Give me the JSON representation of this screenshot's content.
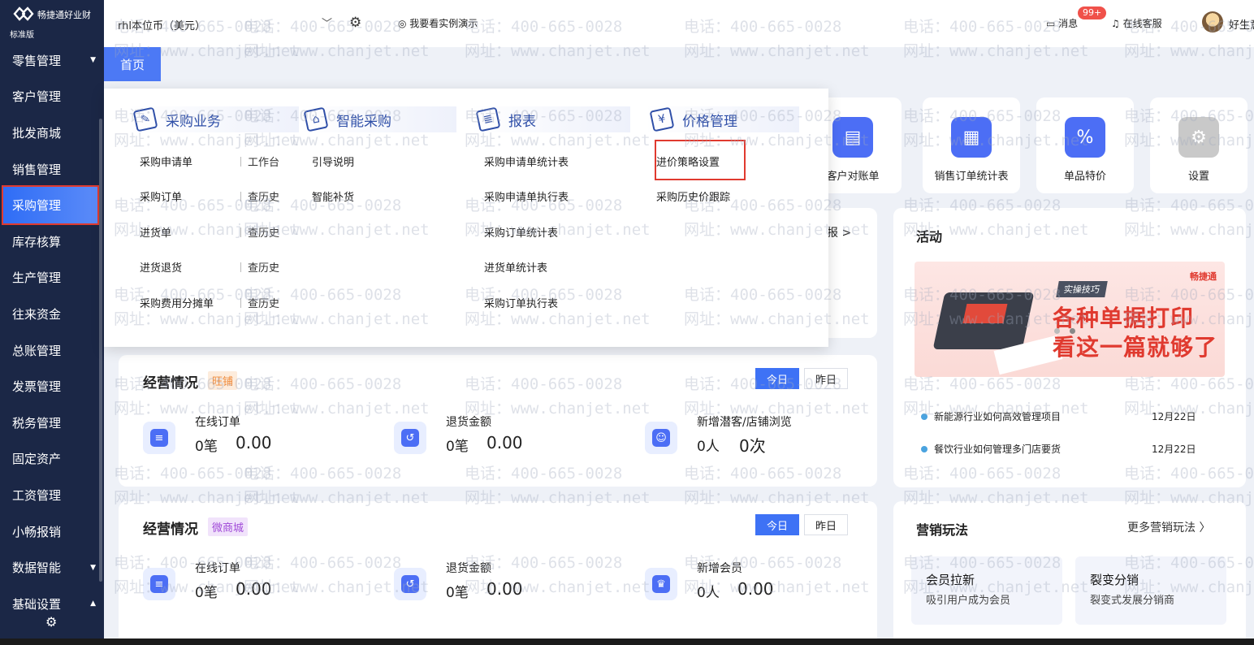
{
  "app": {
    "brand_name": "畅捷通好业财",
    "edition": "标准版"
  },
  "sidebar": {
    "items": [
      {
        "label": "零售管理",
        "caret": "▼"
      },
      {
        "label": "客户管理"
      },
      {
        "label": "批发商城"
      },
      {
        "label": "销售管理"
      },
      {
        "label": "采购管理",
        "active": true
      },
      {
        "label": "库存核算"
      },
      {
        "label": "生产管理"
      },
      {
        "label": "往来资金"
      },
      {
        "label": "总账管理"
      },
      {
        "label": "发票管理"
      },
      {
        "label": "税务管理"
      },
      {
        "label": "固定资产"
      },
      {
        "label": "工资管理"
      },
      {
        "label": "小畅报销"
      },
      {
        "label": "数据智能",
        "caret": "▼"
      },
      {
        "label": "基础设置",
        "caret": "▲"
      }
    ],
    "settings_icon": "gear-icon"
  },
  "topbar": {
    "currency": "rhl本位币（美元）",
    "demo": "我要看实例演示",
    "messages": "消息",
    "badge": "99+",
    "service": "在线客服",
    "user": "好生意"
  },
  "tabs": {
    "home": "首页"
  },
  "mega": {
    "columns": [
      {
        "title": "采购业务",
        "icon": "purchase-icon"
      },
      {
        "title": "智能采购",
        "icon": "basket-icon"
      },
      {
        "title": "报表",
        "icon": "report-icon"
      },
      {
        "title": "价格管理",
        "icon": "price-tag-icon"
      }
    ],
    "purchase_items": [
      {
        "label": "采购申请单",
        "extra": "工作台"
      },
      {
        "label": "采购订单",
        "extra": "查历史"
      },
      {
        "label": "进货单",
        "extra": "查历史"
      },
      {
        "label": "进货退货",
        "extra": "查历史"
      },
      {
        "label": "采购费用分摊单",
        "extra": "查历史"
      }
    ],
    "smart_items": [
      "引导说明",
      "智能补货"
    ],
    "report_items": [
      "采购申请单统计表",
      "采购申请单执行表",
      "采购订单统计表",
      "进货单统计表",
      "采购订单执行表"
    ],
    "price_items": [
      "进价策略设置",
      "采购历史价跟踪"
    ]
  },
  "quick": [
    {
      "label": "客户对账单",
      "icon": "statement-icon"
    },
    {
      "label": "销售订单统计表",
      "icon": "report-icon"
    },
    {
      "label": "单品特价",
      "icon": "discount-icon"
    },
    {
      "label": "设置",
      "icon": "gear-icon"
    }
  ],
  "hidden_link": "报 >",
  "stats1": {
    "title": "经营情况",
    "tag": "旺铺",
    "today": "今日",
    "yesterday": "昨日",
    "metrics": [
      {
        "label": "在线订单",
        "count": "0笔",
        "value": "0.00"
      },
      {
        "label": "退货金额",
        "count": "0笔",
        "value": "0.00"
      },
      {
        "label": "新增潜客/店铺浏览",
        "count": "0人",
        "value": "0次"
      }
    ]
  },
  "stats2": {
    "title": "经营情况",
    "tag": "微商城",
    "today": "今日",
    "yesterday": "昨日",
    "metrics": [
      {
        "label": "在线订单",
        "count": "0笔",
        "value": "0.00"
      },
      {
        "label": "退货金额",
        "count": "0笔",
        "value": "0.00"
      },
      {
        "label": "新增会员",
        "count": "0人",
        "value": "0.00"
      }
    ]
  },
  "activity": {
    "title": "活动",
    "banner_tag": "实操技巧",
    "banner_brand": "畅捷通",
    "banner_line1": "各种单据打印",
    "banner_line2": "看这一篇就够了",
    "news": [
      {
        "title": "新能源行业如何高效管理项目",
        "date": "12月22日"
      },
      {
        "title": "餐饮行业如何管理多门店要货",
        "date": "12月22日"
      }
    ]
  },
  "marketing": {
    "title": "营销玩法",
    "more": "更多营销玩法 〉",
    "boxes": [
      {
        "title": "会员拉新",
        "desc": "吸引用户成为会员"
      },
      {
        "title": "裂变分销",
        "desc": "裂变式发展分销商"
      }
    ]
  },
  "watermark": {
    "phone": "电话：400-665-0028",
    "site": "网址：www.chanjet.net"
  }
}
